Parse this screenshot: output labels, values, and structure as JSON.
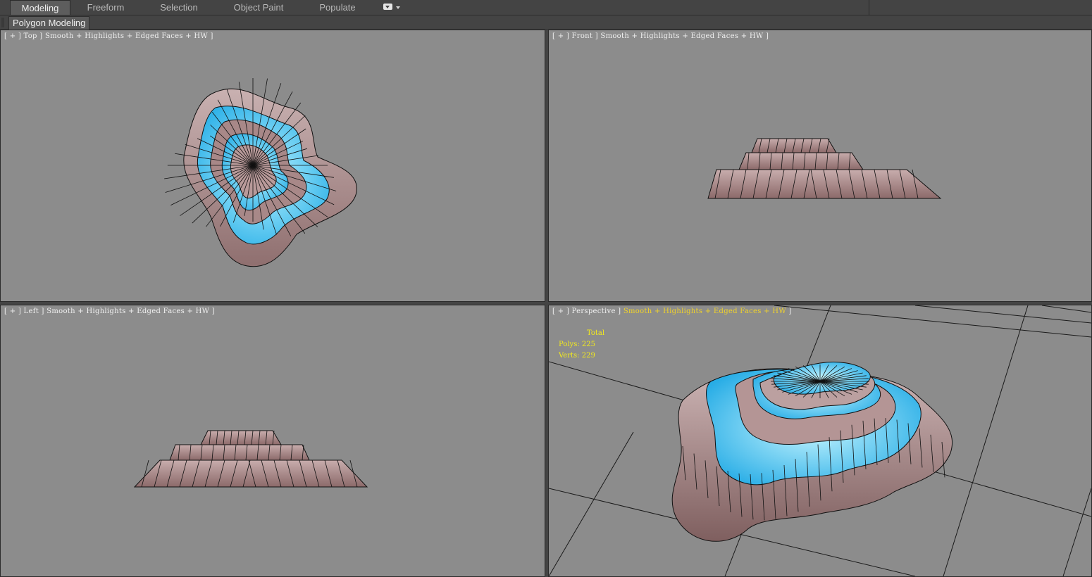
{
  "ribbon": {
    "tabs": [
      {
        "label": "Modeling",
        "active": true
      },
      {
        "label": "Freeform",
        "active": false
      },
      {
        "label": "Selection",
        "active": false
      },
      {
        "label": "Object Paint",
        "active": false
      },
      {
        "label": "Populate",
        "active": false
      }
    ],
    "panel_label": "Polygon Modeling"
  },
  "viewports": {
    "top": {
      "bracket_open": "[",
      "plus": "+",
      "sep": "]",
      "view": "Top",
      "shading": "Smooth + Highlights + Edged Faces + HW",
      "bracket_close": "]"
    },
    "front": {
      "bracket_open": "[",
      "plus": "+",
      "sep": "]",
      "view": "Front",
      "shading": "Smooth + Highlights + Edged Faces + HW",
      "bracket_close": "]"
    },
    "left": {
      "bracket_open": "[",
      "plus": "+",
      "sep": "]",
      "view": "Left",
      "shading": "Smooth + Highlights + Edged Faces + HW",
      "bracket_close": "]"
    },
    "perspective": {
      "bracket_open": "[",
      "plus": "+",
      "sep": "]",
      "view": "Perspective",
      "shading": "Smooth + Highlights + Edged Faces + HW",
      "bracket_close": "]",
      "stats": {
        "total_label": "Total",
        "polys_label": "Polys:",
        "polys": "225",
        "verts_label": "Verts:",
        "verts": "229"
      }
    }
  },
  "colors": {
    "viewport_bg": "#8c8c8c",
    "ui_bg": "#444444",
    "rock": "#a98c8c",
    "water": "#3fbde6",
    "stats_text": "#f3ea1d",
    "active_label": "#f0d22a"
  },
  "icons": {
    "dropdown": "dropdown-menu-icon"
  }
}
